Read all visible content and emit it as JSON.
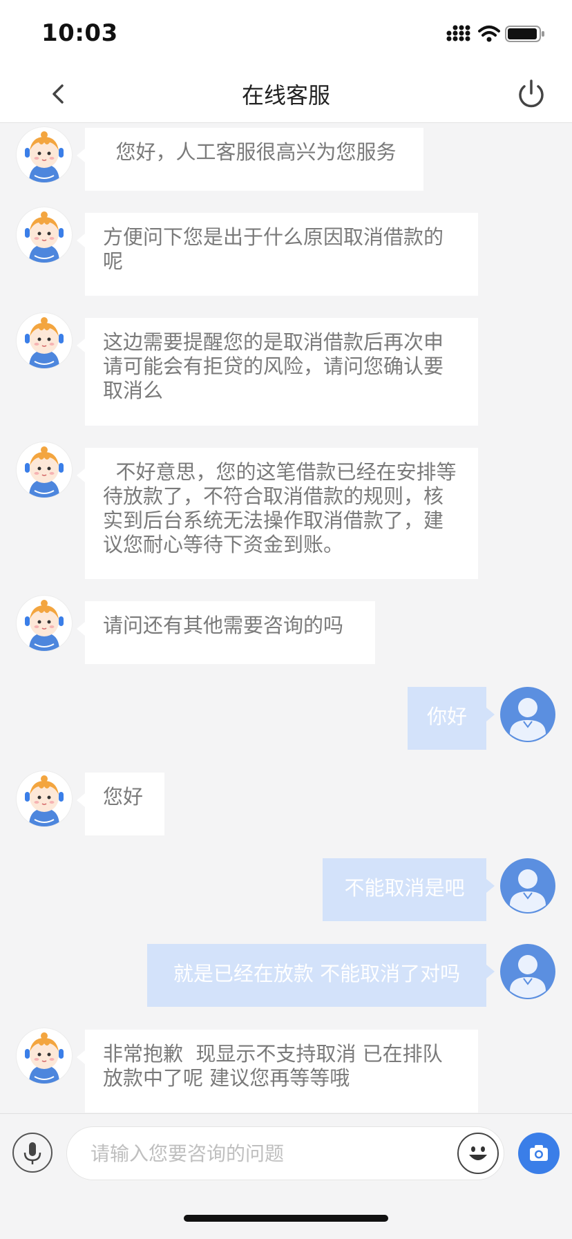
{
  "status_bar": {
    "time": "10:03"
  },
  "nav": {
    "title": "在线客服"
  },
  "messages": [
    {
      "from": "agent",
      "text": "  您好，人工客服很高兴为您服务"
    },
    {
      "from": "agent",
      "text": "方便问下您是出于什么原因取消借款的呢"
    },
    {
      "from": "agent",
      "text": "这边需要提醒您的是取消借款后再次申请可能会有拒贷的风险，请问您确认要取消么"
    },
    {
      "from": "agent",
      "text": "  不好意思，您的这笔借款已经在安排等待放款了，不符合取消借款的规则，核实到后台系统无法操作取消借款了，建议您耐心等待下资金到账。"
    },
    {
      "from": "agent",
      "text": "请问还有其他需要咨询的吗"
    },
    {
      "from": "user",
      "text": "你好"
    },
    {
      "from": "agent",
      "text": "您好"
    },
    {
      "from": "user",
      "text": "不能取消是吧"
    },
    {
      "from": "user",
      "text": "就是已经在放款 不能取消了对吗"
    },
    {
      "from": "agent",
      "text": "非常抱歉  现显示不支持取消 已在排队放款中了呢 建议您再等等哦"
    }
  ],
  "input": {
    "placeholder": "请输入您要咨询的问题",
    "value": ""
  },
  "colors": {
    "user_bubble": "#d3e2fa",
    "user_avatar": "#5b8fe0",
    "accent": "#3a7ee8",
    "background": "#f4f4f5"
  },
  "icons": {
    "back": "chevron-left-icon",
    "power": "power-icon",
    "mic": "microphone-icon",
    "emoji": "smiley-icon",
    "camera": "camera-icon"
  }
}
